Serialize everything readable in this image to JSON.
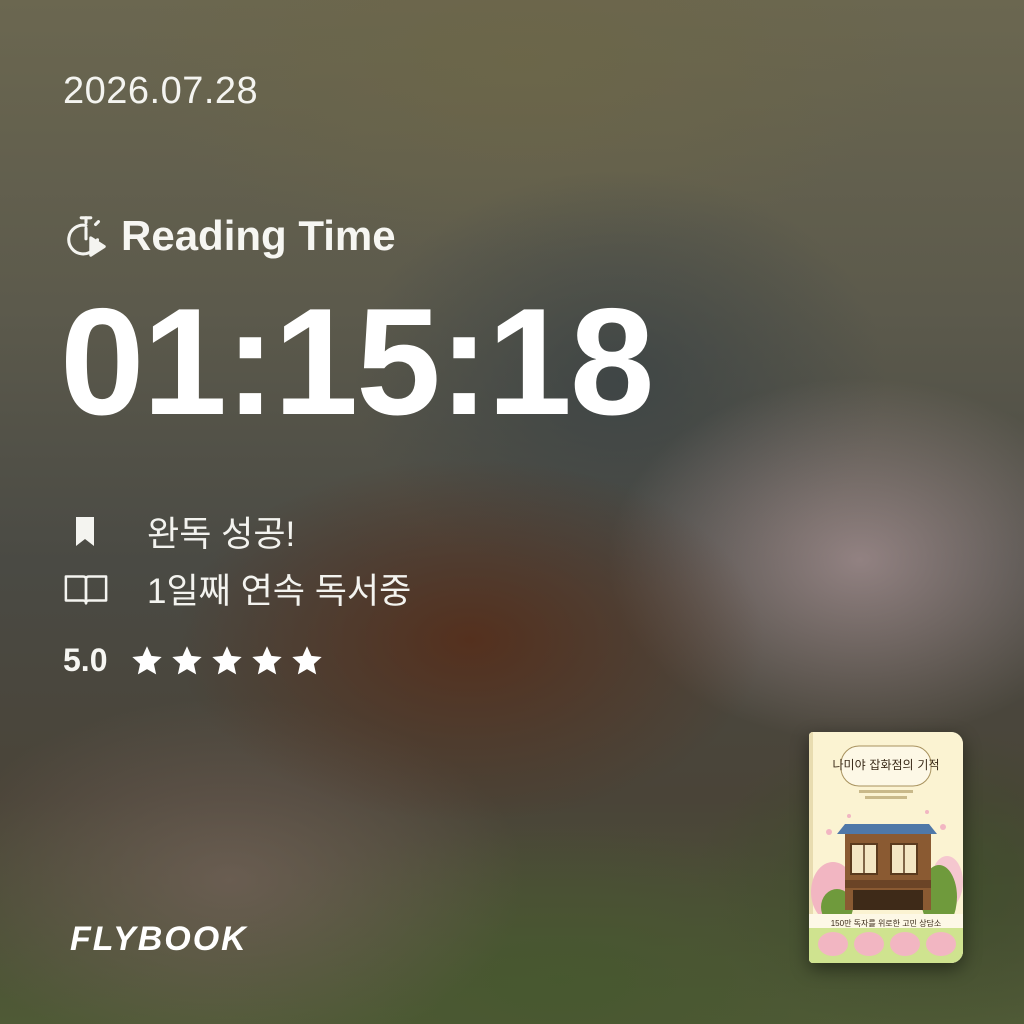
{
  "date": "2026.07.28",
  "reading_time": {
    "icon": "stopwatch-play-icon",
    "label": "Reading Time",
    "value": "01:15:18"
  },
  "status": [
    {
      "icon": "bookmark-icon",
      "text": "완독 성공!"
    },
    {
      "icon": "open-book-icon",
      "text": "1일째 연속 독서중"
    }
  ],
  "rating": {
    "score": "5.0",
    "stars": 5,
    "max_stars": 5
  },
  "brand": {
    "logo_text": "FLYBOOK"
  },
  "book_cover": {
    "title": "나미야 잡화점의 기적",
    "tagline": "150만 독자를 위로한 고민 상담소",
    "colors": {
      "background": "#fbf3d2",
      "roof": "#4f78a8",
      "wall": "#8a5a32",
      "foliage": "#6f9a3c",
      "blossom": "#f2b6c2",
      "band": "#cfe38f"
    }
  }
}
